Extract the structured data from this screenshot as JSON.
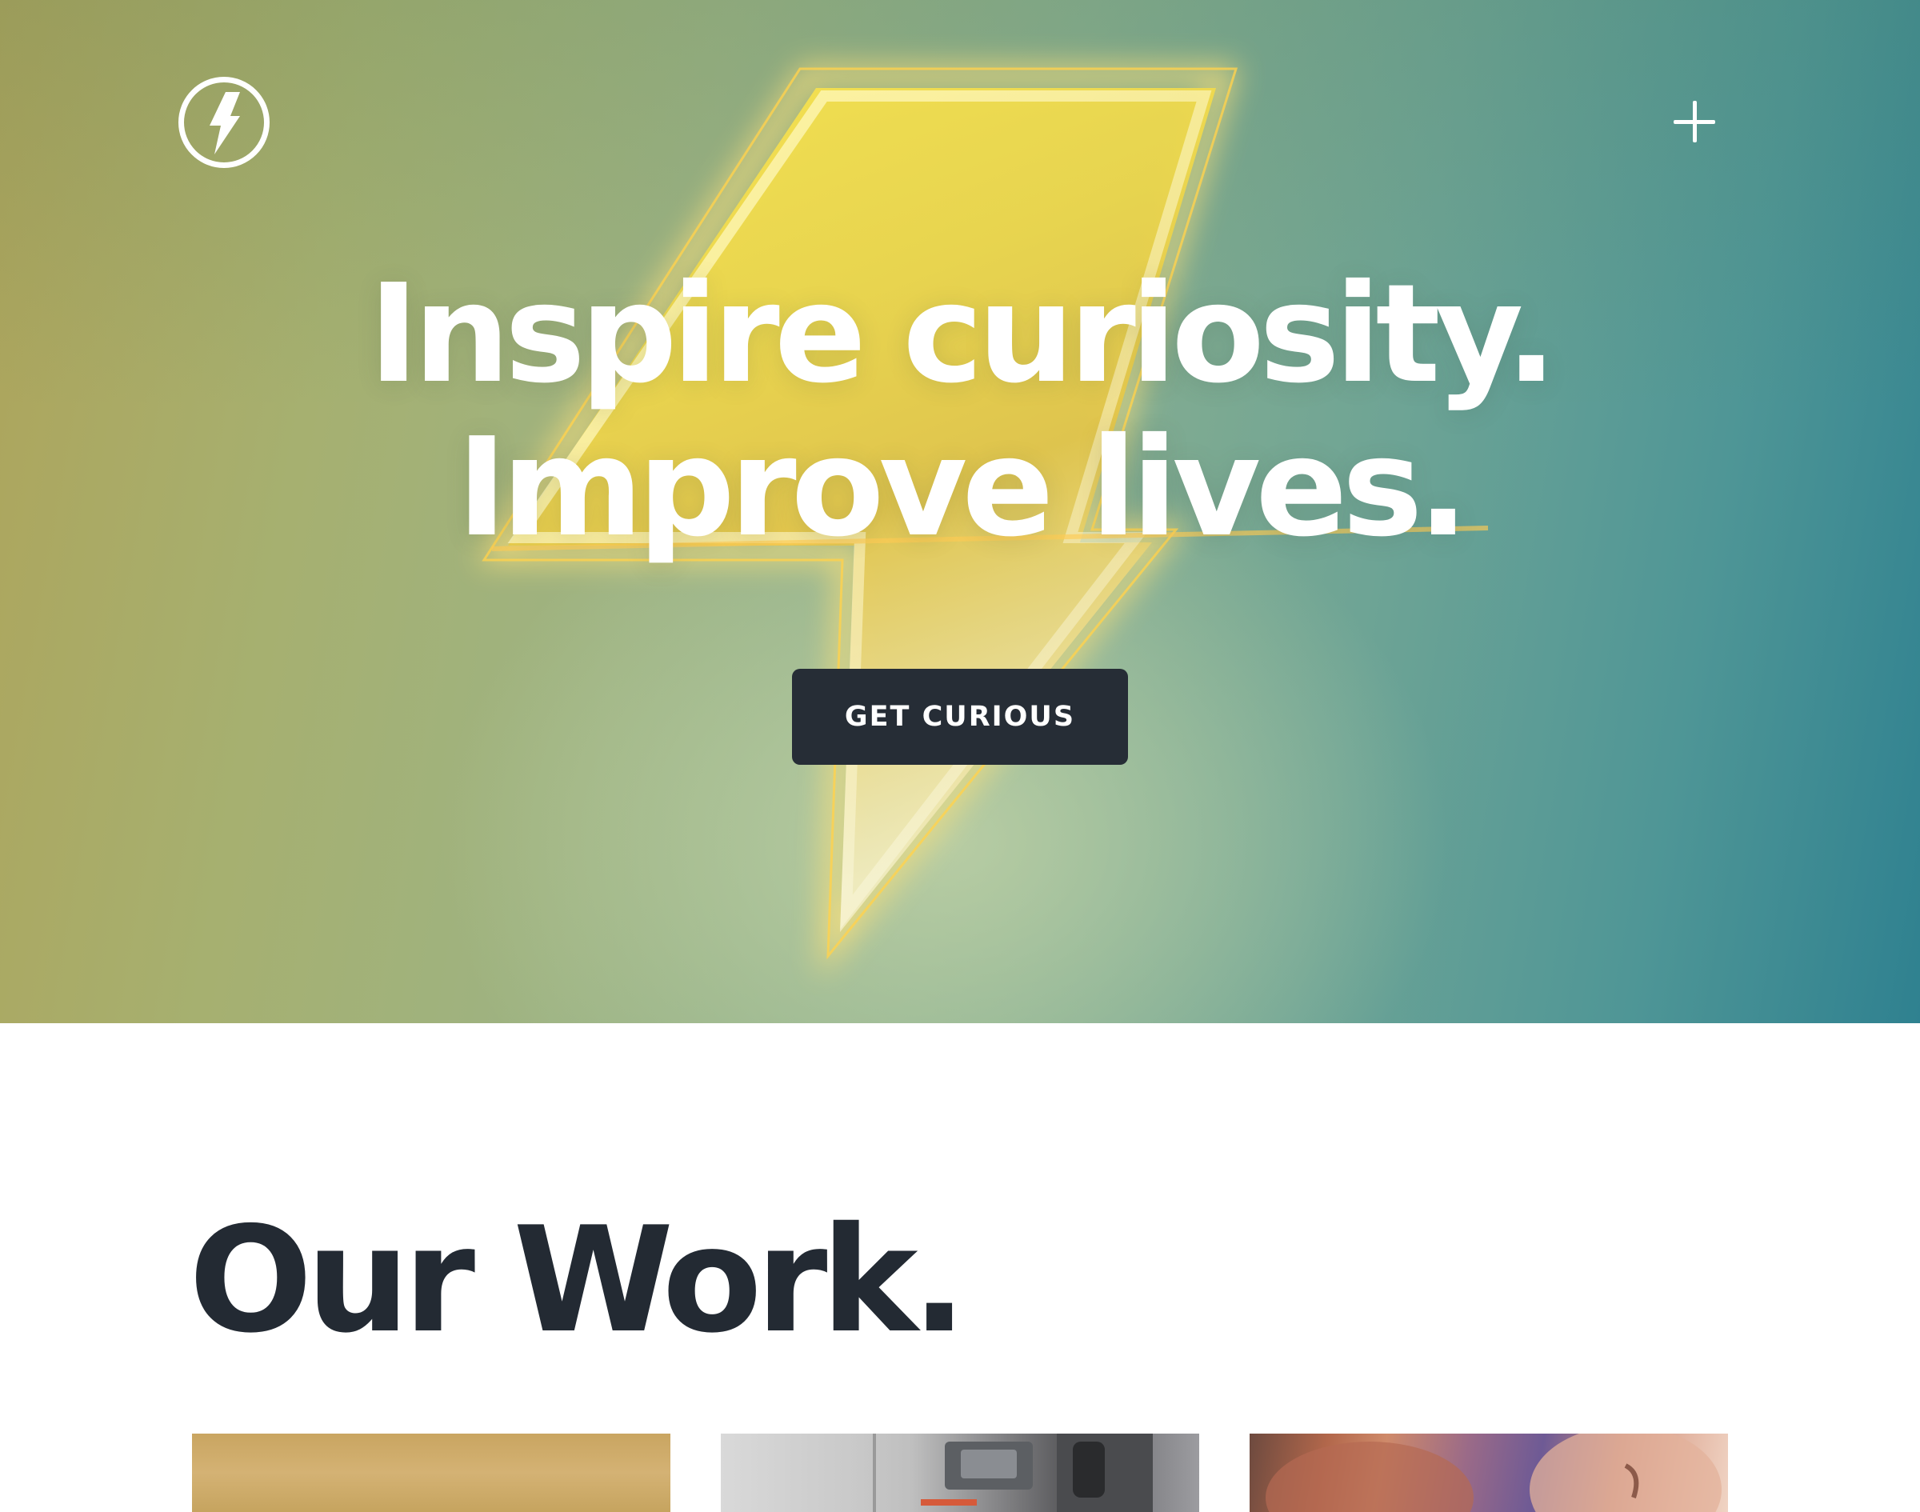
{
  "header": {
    "logo_icon": "lightning-bolt-circle-icon",
    "menu_icon": "plus-icon"
  },
  "hero": {
    "title_line1": "Inspire curiosity.",
    "title_line2": "Improve lives.",
    "cta_label": "GET CURIOUS",
    "colors": {
      "gradient_left": "#aea45a",
      "gradient_mid": "#9db383",
      "gradient_right": "#2f8190",
      "bolt_yellow": "#f5e04a",
      "cta_background": "#262d36"
    }
  },
  "work": {
    "title": "Our Work.",
    "cards": [
      {
        "name": "work-card-1"
      },
      {
        "name": "work-card-2"
      },
      {
        "name": "work-card-3"
      }
    ],
    "colors": {
      "title_color": "#232a33"
    }
  }
}
